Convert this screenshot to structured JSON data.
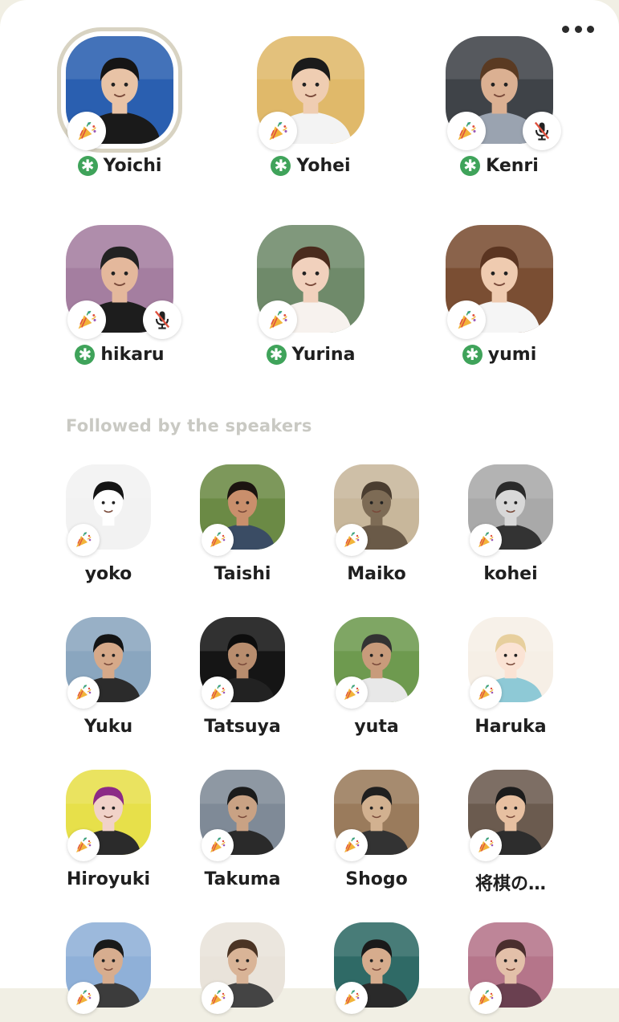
{
  "menu": {
    "more_icon": "more-dots-icon"
  },
  "speakers": [
    {
      "name": "Yoichi",
      "moderator": true,
      "muted": false,
      "bg": "#2a5fb0",
      "skin": "#e8c3a6",
      "hair": "#151515",
      "shirt": "#1a1a1a",
      "ring": true
    },
    {
      "name": "Yohei",
      "moderator": true,
      "muted": false,
      "bg": "#e0b96a",
      "skin": "#efcdb2",
      "hair": "#1b1b1b",
      "shirt": "#f3f3f3",
      "ring": false
    },
    {
      "name": "Kenri",
      "moderator": true,
      "muted": true,
      "bg": "#3f4348",
      "skin": "#dbb092",
      "hair": "#5a3a22",
      "shirt": "#9aa3b0",
      "ring": false
    },
    {
      "name": "hikaru",
      "moderator": true,
      "muted": true,
      "bg": "#a47ea0",
      "skin": "#e4b89c",
      "hair": "#222222",
      "shirt": "#1d1d1d",
      "ring": false
    },
    {
      "name": "Yurina",
      "moderator": true,
      "muted": false,
      "bg": "#6f8a6a",
      "skin": "#f1d1bd",
      "hair": "#4a2b1d",
      "shirt": "#f7f2ee",
      "ring": false
    },
    {
      "name": "yumi",
      "moderator": true,
      "muted": false,
      "bg": "#7a4e33",
      "skin": "#efcbb0",
      "hair": "#5b3521",
      "shirt": "#f5f5f5",
      "ring": false
    }
  ],
  "section_title": "Followed by the speakers",
  "audience": [
    {
      "name": "yoko",
      "bg": "#f2f2f2",
      "skin": "#ffffff",
      "hair": "#141414",
      "shirt": "#f2f2f2"
    },
    {
      "name": "Taishi",
      "bg": "#6b8a45",
      "skin": "#c98f6c",
      "hair": "#1b1410",
      "shirt": "#3a4c64"
    },
    {
      "name": "Maiko",
      "bg": "#c8b79b",
      "skin": "#7d6b55",
      "hair": "#4a3d30",
      "shirt": "#6a5a48"
    },
    {
      "name": "kohei",
      "bg": "#a9a9a9",
      "skin": "#d8d8d8",
      "hair": "#2a2a2a",
      "shirt": "#333333"
    },
    {
      "name": "Yuku",
      "bg": "#8aa6bf",
      "skin": "#d6a989",
      "hair": "#141414",
      "shirt": "#2b2b2b"
    },
    {
      "name": "Tatsuya",
      "bg": "#151515",
      "skin": "#b88d6e",
      "hair": "#0d0d0d",
      "shirt": "#222222"
    },
    {
      "name": "yuta",
      "bg": "#6e9a4f",
      "skin": "#c89b7b",
      "hair": "#333333",
      "shirt": "#e8e8e8"
    },
    {
      "name": "Haruka",
      "bg": "#f6efe6",
      "skin": "#fbe3d4",
      "hair": "#e7cf9d",
      "shirt": "#8ec9d6"
    },
    {
      "name": "Hiroyuki",
      "bg": "#e7e04a",
      "skin": "#f1d2c8",
      "hair": "#8c2a86",
      "shirt": "#2b2b2b"
    },
    {
      "name": "Takuma",
      "bg": "#7f8a97",
      "skin": "#c9a284",
      "hair": "#1b1b1b",
      "shirt": "#2a2a2a"
    },
    {
      "name": "Shogo",
      "bg": "#9a7b5c",
      "skin": "#d2b190",
      "hair": "#1f1f1f",
      "shirt": "#333333"
    },
    {
      "name": "将棋の…",
      "bg": "#6b5b4f",
      "skin": "#e7c0a1",
      "hair": "#1c1c1c",
      "shirt": "#2d2d2d"
    },
    {
      "name": "",
      "bg": "#8fb0d8",
      "skin": "#d7ad8f",
      "hair": "#1a1a1a",
      "shirt": "#3c3c3c"
    },
    {
      "name": "",
      "bg": "#e9e3da",
      "skin": "#d9b497",
      "hair": "#4b3424",
      "shirt": "#444444"
    },
    {
      "name": "",
      "bg": "#2f6a66",
      "skin": "#d6ac8d",
      "hair": "#1a1a1a",
      "shirt": "#2a2a2a"
    },
    {
      "name": "",
      "bg": "#b5758a",
      "skin": "#e3c0a9",
      "hair": "#4a2e2e",
      "shirt": "#6a4050"
    }
  ]
}
